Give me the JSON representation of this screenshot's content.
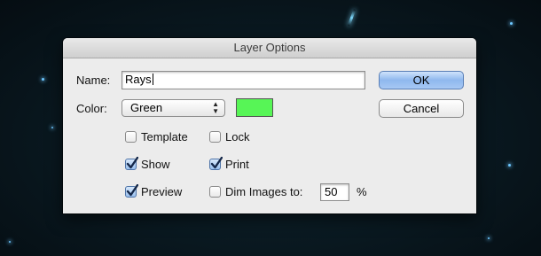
{
  "dialog": {
    "title": "Layer Options",
    "name_label": "Name:",
    "name_value": "Rays",
    "color_label": "Color:",
    "color_value": "Green",
    "color_swatch": "#57f556",
    "ok_label": "OK",
    "cancel_label": "Cancel",
    "options": {
      "template": {
        "label": "Template",
        "checked": false
      },
      "lock": {
        "label": "Lock",
        "checked": false
      },
      "show": {
        "label": "Show",
        "checked": true
      },
      "print": {
        "label": "Print",
        "checked": true
      },
      "preview": {
        "label": "Preview",
        "checked": true
      },
      "dim": {
        "label": "Dim Images to:",
        "checked": false
      }
    },
    "dim_value": "50",
    "dim_unit": "%"
  },
  "colors": {
    "accent_button": "#8fb8ee",
    "desktop": "#0a1a22"
  }
}
